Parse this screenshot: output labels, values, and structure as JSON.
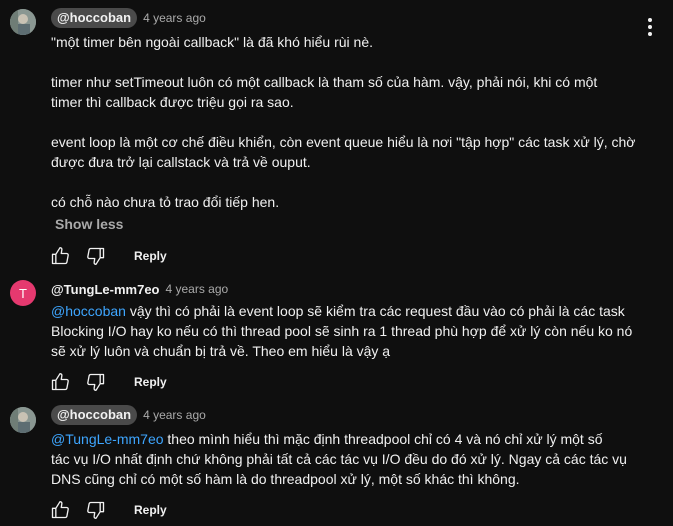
{
  "comments": [
    {
      "author": "@hoccoban",
      "time": "4 years ago",
      "paragraphs": [
        "\"một timer bên ngoài callback\" là đã khó hiểu rùi nè.",
        "timer như setTimeout luôn có một callback là tham số của hàm. vậy, phải nói, khi có một",
        "timer thì callback được triệu gọi ra sao.",
        "event loop là một cơ chế điều khiển, còn event queue hiểu là nơi \"tập hợp\" các task xử lý, chờ",
        "được đưa trở lại callstack và trả về ouput.",
        "có chỗ nào chưa tỏ trao đổi tiếp hen."
      ],
      "show_less": "Show less",
      "reply": "Reply"
    },
    {
      "avatar_letter": "T",
      "author": "@TungLe-mm7eo",
      "time": "4 years ago",
      "mention": "@hoccoban",
      "line1": " vậy thì có phải là event loop sẽ kiểm tra các request đầu vào có phải là các task",
      "line2": "Blocking I/O hay ko nếu có thì thread pool sẽ sinh ra 1 thread phù hợp để xử lý còn nếu ko nó",
      "line3": "sẽ xử lý luôn và chuẩn bị trả về. Theo em hiểu là vậy ạ",
      "reply": "Reply"
    },
    {
      "author": "@hoccoban",
      "time": "4 years ago",
      "mention": "@TungLe-mm7eo",
      "line1": " theo mình hiểu thì mặc định threadpool chỉ có 4 và nó chỉ xử lý một số",
      "line2": "tác vụ I/O nhất định chứ không phải tất cả các tác vụ I/O đều do đó xử lý. Ngay cả các tác vụ",
      "line3": "DNS cũng chỉ có một số hàm là do threadpool xử lý, một số khác thì không.",
      "reply": "Reply"
    }
  ],
  "colors": {
    "background": "#0f0f0f",
    "mention": "#3ea6ff",
    "chip": "#4a4a4a",
    "avatar_t": "#e5396f"
  },
  "icons": [
    "like-icon",
    "dislike-icon",
    "more-options-icon"
  ]
}
